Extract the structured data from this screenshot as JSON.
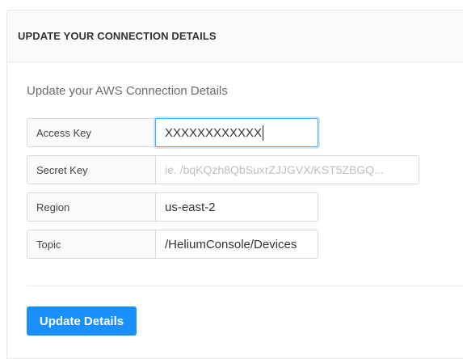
{
  "card": {
    "title": "UPDATE YOUR CONNECTION DETAILS",
    "subtitle": "Update your AWS Connection Details"
  },
  "fields": [
    {
      "label": "Access Key",
      "value": "XXXXXXXXXXXX",
      "placeholder": ""
    },
    {
      "label": "Secret Key",
      "value": "",
      "placeholder": "ie. /bqKQzh8QbSuxrZJJGVX/KST5ZBGQ..."
    },
    {
      "label": "Region",
      "value": "us-east-2",
      "placeholder": ""
    },
    {
      "label": "Topic",
      "value": "/HeliumConsole/Devices",
      "placeholder": ""
    }
  ],
  "actions": {
    "update_label": "Update Details"
  },
  "colors": {
    "primary": "#1890ff",
    "focus_border": "#40a9ff"
  }
}
